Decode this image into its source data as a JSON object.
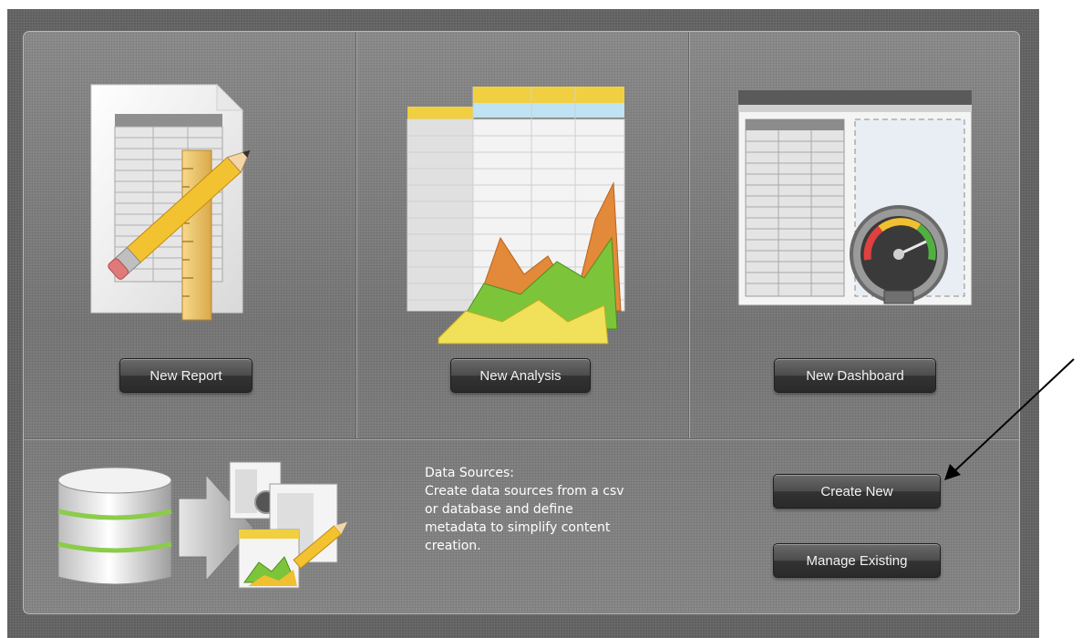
{
  "tiles": [
    {
      "label": "New Report",
      "icon": "report-icon"
    },
    {
      "label": "New Analysis",
      "icon": "analysis-icon"
    },
    {
      "label": "New Dashboard",
      "icon": "dashboard-icon"
    }
  ],
  "data_sources": {
    "icon": "data-sources-icon",
    "description_lines": [
      "Data Sources:",
      "Create data sources from a csv",
      "or database and define",
      "metadata to simplify content",
      "creation."
    ],
    "create_label": "Create New",
    "manage_label": "Manage Existing"
  },
  "annotation": {
    "icon": "arrow-annotation-icon"
  }
}
